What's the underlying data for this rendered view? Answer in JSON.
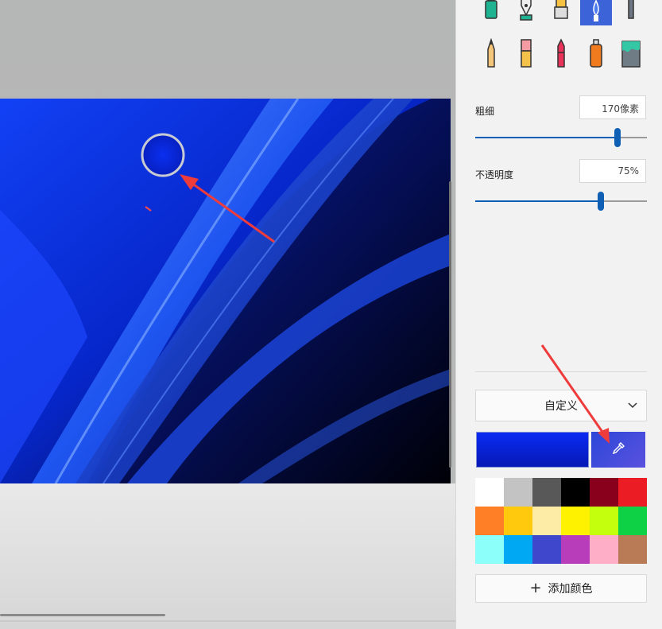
{
  "panel": {
    "thickness": {
      "label": "粗细",
      "value": "170像素",
      "level": 0.83
    },
    "opacity": {
      "label": "不透明度",
      "value": "75%",
      "level": 0.75
    },
    "palette_dropdown": {
      "selected": "自定义"
    },
    "add_color_label": "添加颜色",
    "colors": {
      "accent": "#0f5fb5",
      "current": "#0b24d8",
      "swatches": [
        "#ffffff",
        "#c3c3c3",
        "#585858",
        "#000000",
        "#88001b",
        "#ec1c24",
        "#ff7f27",
        "#ffc90e",
        "#fdeca6",
        "#fff200",
        "#c4ff0e",
        "#0ed145",
        "#8cfffb",
        "#00a8f3",
        "#3f48cc",
        "#b83dba",
        "#ffaec8",
        "#b97a56"
      ]
    },
    "tools": [
      {
        "name": "marker-icon"
      },
      {
        "name": "calligraphy-pen-icon"
      },
      {
        "name": "oil-brush-icon"
      },
      {
        "name": "watercolor-brush-icon",
        "selected": true
      },
      {
        "name": "pencil-gray-icon"
      },
      {
        "name": "pencil-icon"
      },
      {
        "name": "eraser-icon"
      },
      {
        "name": "crayon-icon"
      },
      {
        "name": "spray-can-icon"
      },
      {
        "name": "fill-bucket-icon"
      }
    ]
  }
}
